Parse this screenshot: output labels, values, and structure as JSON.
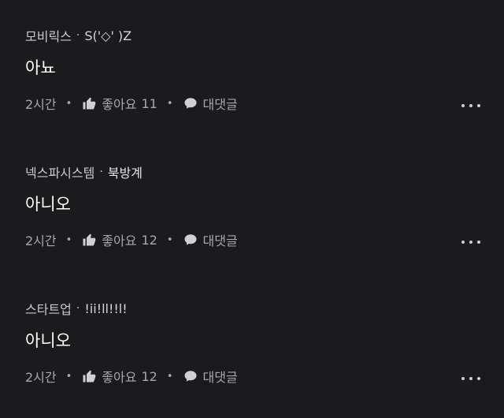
{
  "comments": [
    {
      "author": "모비릭스",
      "separator": "·",
      "nickname": "S('◇' )Z",
      "text": "아뇨",
      "time": "2시간",
      "like_label": "좋아요",
      "like_count": "11",
      "reply_label": "대댓글"
    },
    {
      "author": "넥스파시스템",
      "separator": "·",
      "nickname": "북방계",
      "text": "아니오",
      "time": "2시간",
      "like_label": "좋아요",
      "like_count": "12",
      "reply_label": "대댓글"
    },
    {
      "author": "스타트업",
      "separator": "·",
      "nickname": "!ii!ll!!l!",
      "text": "아니오",
      "time": "2시간",
      "like_label": "좋아요",
      "like_count": "12",
      "reply_label": "대댓글"
    }
  ],
  "icons": {
    "like": "thumbs-up-icon",
    "reply": "speech-bubble-icon",
    "more": "more-horizontal-icon"
  },
  "colors": {
    "background": "#1b1b1d",
    "primary_text": "#ffffff",
    "secondary_text": "#a8a8ab"
  }
}
